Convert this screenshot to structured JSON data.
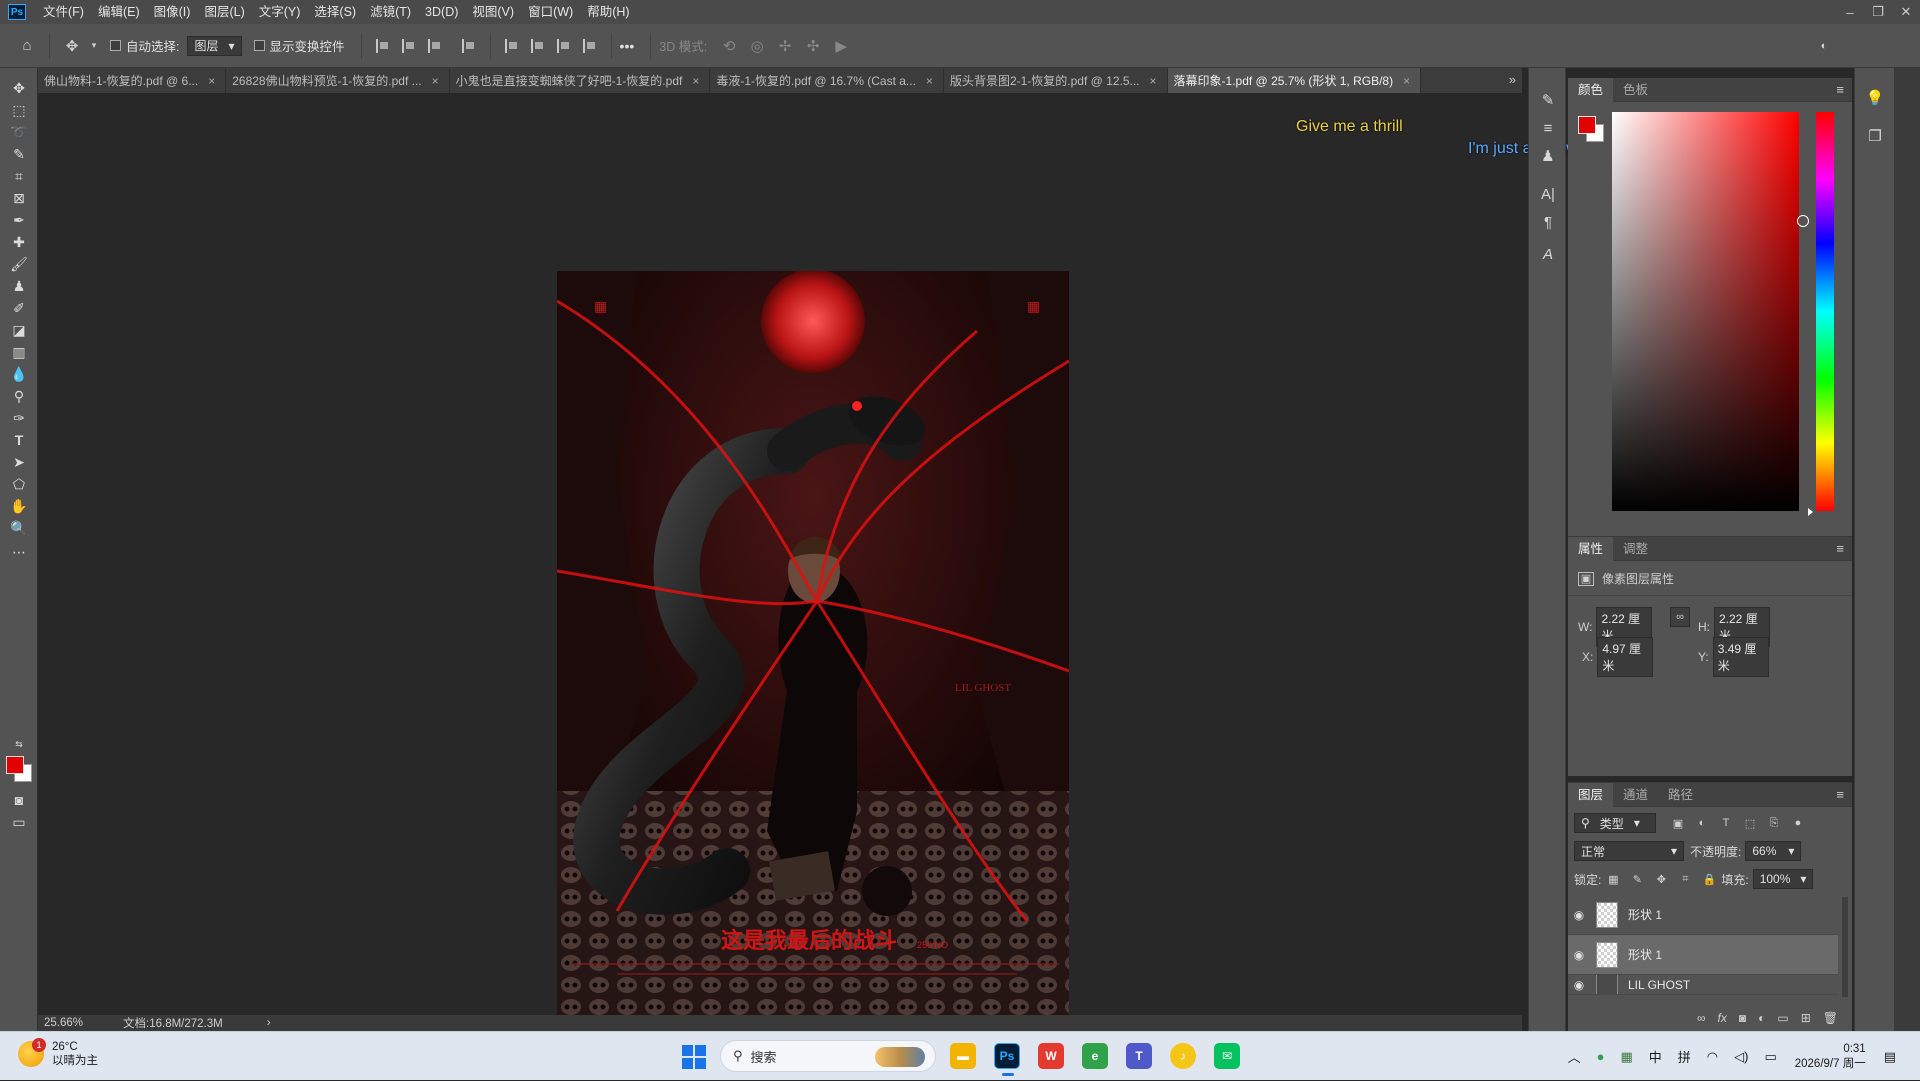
{
  "app": {
    "logo": "Ps"
  },
  "menu": [
    "文件(F)",
    "编辑(E)",
    "图像(I)",
    "图层(L)",
    "文字(Y)",
    "选择(S)",
    "滤镜(T)",
    "3D(D)",
    "视图(V)",
    "窗口(W)",
    "帮助(H)"
  ],
  "options": {
    "auto_select_label": "自动选择:",
    "auto_select_value": "图层",
    "show_transform_label": "显示变换控件",
    "mode3d_label": "3D 模式:",
    "more": "•••"
  },
  "tabs": [
    {
      "label": "佛山物料-1-恢复的.pdf @ 6...",
      "active": false
    },
    {
      "label": "26828佛山物料预览-1-恢复的.pdf ...",
      "active": false
    },
    {
      "label": "小鬼也是直接变蜘蛛侠了好吧-1-恢复的.pdf",
      "active": false
    },
    {
      "label": "毒液-1-恢复的.pdf @ 16.7% (Cast a...",
      "active": false
    },
    {
      "label": "版头背景图2-1-恢复的.pdf @ 12.5...",
      "active": false
    },
    {
      "label": "落幕印象-1.pdf @ 25.7% (形状 1, RGB/8)",
      "active": true
    }
  ],
  "canvas": {
    "lyric_line1": "Give me a thrill",
    "lyric_line2": "I'm just a guy with a gun",
    "poster_title": "这是我最后的战斗",
    "poster_tag": "LIL GHOST",
    "poster_small": "250 NO"
  },
  "status": {
    "zoom": "25.66%",
    "doc": "文档:16.8M/272.3M",
    "arrow": "›"
  },
  "color_panel": {
    "tabs": [
      "颜色",
      "色板"
    ],
    "fg": "#e30000",
    "bg": "#ffffff"
  },
  "properties": {
    "tabs": [
      "属性",
      "调整"
    ],
    "title": "像素图层属性",
    "w_label": "W:",
    "w": "2.22 厘米",
    "h_label": "H:",
    "h": "2.22 厘米",
    "x_label": "X:",
    "x": "4.97 厘米",
    "y_label": "Y:",
    "y": "3.49 厘米",
    "link_symbol": "∞"
  },
  "layers": {
    "tabs": [
      "图层",
      "通道",
      "路径"
    ],
    "filter_label": "类型",
    "blend_mode": "正常",
    "opacity_label": "不透明度:",
    "opacity": "66%",
    "lock_label": "锁定:",
    "fill_label": "填充:",
    "fill": "100%",
    "items": [
      {
        "name": "形状 1",
        "visible": true,
        "selected": false
      },
      {
        "name": "形状 1",
        "visible": true,
        "selected": true
      }
    ],
    "partial_item": "LIL GHOST",
    "footer_fx": "fx"
  },
  "taskbar": {
    "weather_temp": "26°C",
    "weather_desc": "以晴为主",
    "weather_badge": "1",
    "search_label": "搜索",
    "ime_lang": "中",
    "ime_mode": "拼",
    "time": "0:31",
    "date": "2026/9/7 周一"
  }
}
